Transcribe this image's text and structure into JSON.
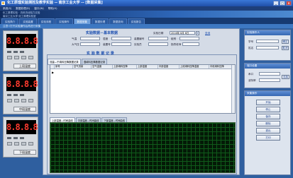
{
  "window": {
    "title": "化工原理实验测控及教学实验 -- 南京工业大学 -- [数据采集]"
  },
  "menu": [
    "系统(S)",
    "数据处理(D)",
    "窗口(W)",
    "帮助(H)"
  ],
  "banner": {
    "line1": "化工原理实验 · 流体流动阻力实验",
    "line2": "南京工业大学 化工原理实验室"
  },
  "tabs": [
    "实验简介",
    "实验装置",
    "实验流程",
    "实验操作",
    "数据采集",
    "数据处理",
    "数据查询",
    "实验报告"
  ],
  "active_tab": "数据采集",
  "hint": "注意!!打开实验操作后再进行采集",
  "devices": [
    {
      "display": "8.8.8.8",
      "label": "上段温度"
    },
    {
      "display": "8.8.8.8",
      "label": "中段温度"
    },
    {
      "display": "8.8.8.8",
      "label": "下段温度"
    }
  ],
  "basic": {
    "title": "实验数据－基本数据",
    "date_label": "实验日期",
    "date_value": "2016年 6月 6日",
    "query_link": "查询",
    "row1": [
      {
        "label": "气温"
      },
      {
        "label": "湿度"
      },
      {
        "label": "装置编号"
      },
      {
        "label": "组别"
      }
    ],
    "row2": [
      {
        "label": "大气压"
      },
      {
        "label": "装置号"
      },
      {
        "label": "实验员"
      },
      {
        "label": "指导老师"
      }
    ]
  },
  "records": {
    "title": "实 验 数 据 记 录",
    "subtabs": [
      "流量—干填料压降数据记录",
      "湿填料压降数据记录"
    ],
    "columns": [
      "序号",
      "空气流量",
      "空气温度",
      "上部填料压降",
      "上部温度",
      "中部温度",
      "上段填料压降温度",
      "中段填料压降"
    ],
    "row_marker": "▶"
  },
  "chart_tabs": [
    "上部温度—时间曲线",
    "中部温度—时间曲线",
    "下部温度—时间曲线"
  ],
  "right": {
    "setup": {
      "title": "实验操作人",
      "labels": [
        "学号",
        "姓名"
      ],
      "btn": "确定",
      "btn2": "取消"
    },
    "comm": {
      "title": "端口设置",
      "labels": [
        "串口",
        "波特率"
      ],
      "btn": "连接"
    },
    "ops": {
      "title": "采集操作",
      "buttons": [
        "开始",
        "停止",
        "保存",
        "删除",
        "退出",
        "打印"
      ]
    }
  }
}
